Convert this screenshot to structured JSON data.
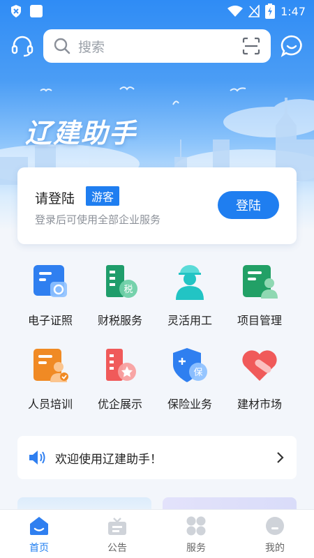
{
  "status": {
    "time": "1:47"
  },
  "search": {
    "placeholder": "搜索"
  },
  "brand": {
    "title": "辽建助手"
  },
  "login": {
    "title": "请登陆",
    "badge": "游客",
    "subtitle": "登录后可使用全部企业服务",
    "button": "登陆"
  },
  "services": [
    {
      "label": "电子证照",
      "icon": "certificate-icon",
      "color": "#2f7ff0"
    },
    {
      "label": "财税服务",
      "icon": "tax-building-icon",
      "color": "#1f9d6b"
    },
    {
      "label": "灵活用工",
      "icon": "worker-icon",
      "color": "#22c4c4"
    },
    {
      "label": "项目管理",
      "icon": "project-doc-icon",
      "color": "#22a066"
    },
    {
      "label": "人员培训",
      "icon": "training-doc-icon",
      "color": "#f08a24"
    },
    {
      "label": "优企展示",
      "icon": "enterprise-star-icon",
      "color": "#f05a5a"
    },
    {
      "label": "保险业务",
      "icon": "insurance-shield-icon",
      "color": "#2f7ff0"
    },
    {
      "label": "建材市场",
      "icon": "heart-tag-icon",
      "color": "#f05a5a"
    }
  ],
  "notice": {
    "text": "欢迎使用辽建助手！"
  },
  "tabs": [
    {
      "label": "首页",
      "icon": "home-icon",
      "active": true
    },
    {
      "label": "公告",
      "icon": "announcement-icon",
      "active": false
    },
    {
      "label": "服务",
      "icon": "service-grid-icon",
      "active": false
    },
    {
      "label": "我的",
      "icon": "profile-icon",
      "active": false
    }
  ],
  "colors": {
    "primary": "#1f7ef0",
    "background": "#f3f6fb"
  }
}
